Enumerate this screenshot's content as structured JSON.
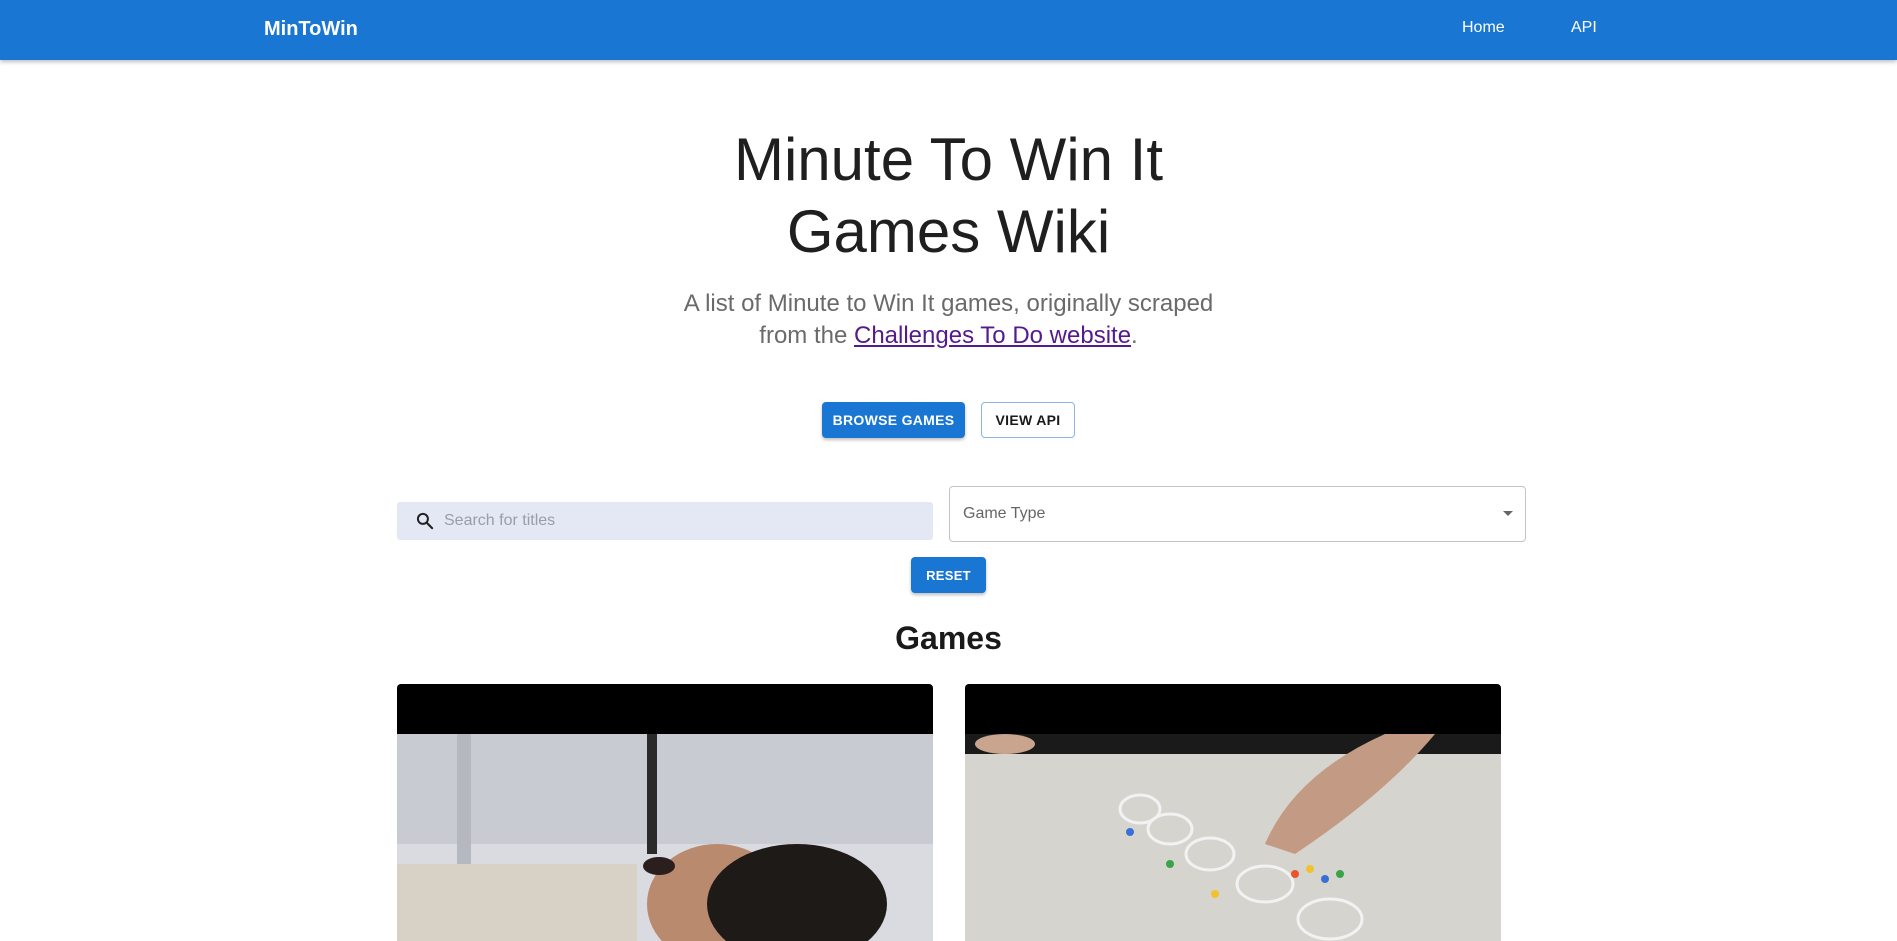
{
  "header": {
    "brand": "MinToWin",
    "nav": [
      {
        "label": "Home"
      },
      {
        "label": "API"
      }
    ]
  },
  "hero": {
    "title_line1": "Minute To Win It",
    "title_line2": "Games Wiki",
    "subtitle_part1": "A list of Minute to Win It games, originally scraped",
    "subtitle_part2": "from the ",
    "subtitle_link": "Challenges To Do website",
    "subtitle_end": "."
  },
  "actions": {
    "browse_label": "Browse Games",
    "api_label": "View API"
  },
  "filters": {
    "search_placeholder": "Search for titles",
    "search_value": "",
    "game_type_label": "Game Type",
    "reset_label": "Reset"
  },
  "games": {
    "title": "Games"
  },
  "colors": {
    "primary": "#1976d2",
    "search_bg": "#e4e7f4",
    "link": "#551a8b"
  },
  "icons": {
    "search": "search-icon",
    "dropdown": "caret-down-icon"
  }
}
